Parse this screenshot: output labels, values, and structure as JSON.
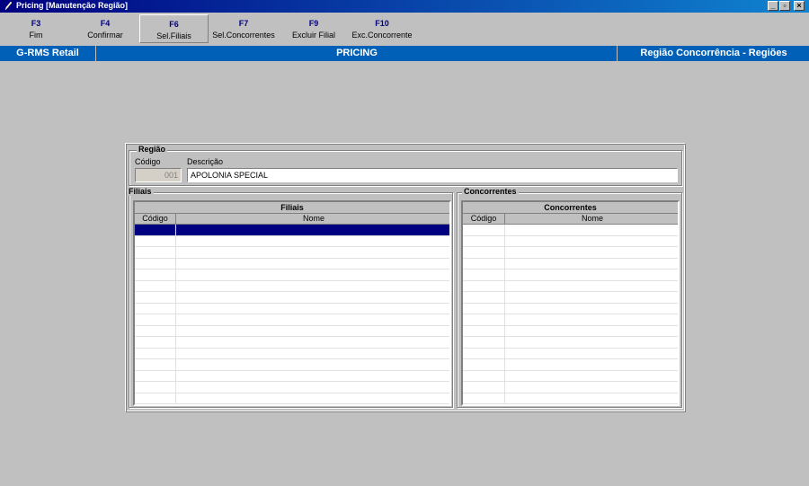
{
  "window": {
    "title": "Pricing [Manutenção Região]"
  },
  "toolbar": {
    "items": [
      {
        "key": "F3",
        "label": "Fim"
      },
      {
        "key": "F4",
        "label": "Confirmar"
      },
      {
        "key": "F6",
        "label": "Sel.Filiais"
      },
      {
        "key": "F7",
        "label": "Sel.Concorrentes"
      },
      {
        "key": "F9",
        "label": "Excluir Filial"
      },
      {
        "key": "F10",
        "label": "Exc.Concorrente"
      }
    ]
  },
  "banner": {
    "left": "G-RMS Retail",
    "center": "PRICING",
    "right": "Região Concorrência - Regiões"
  },
  "regiao": {
    "legend": "Região",
    "codigo_label": "Código",
    "codigo_value": "001",
    "descricao_label": "Descrição",
    "descricao_value": "APOLONIA SPECIAL"
  },
  "filiais": {
    "legend": "Filiais",
    "grid_title": "Filiais",
    "columns": [
      "Código",
      "Nome"
    ]
  },
  "concorrentes": {
    "legend": "Concorrentes",
    "grid_title": "Concorrentes",
    "columns": [
      "Código",
      "Nome"
    ]
  },
  "colors": {
    "banner": "#0060b8",
    "selection": "#000080",
    "titlebar": "#000080"
  }
}
